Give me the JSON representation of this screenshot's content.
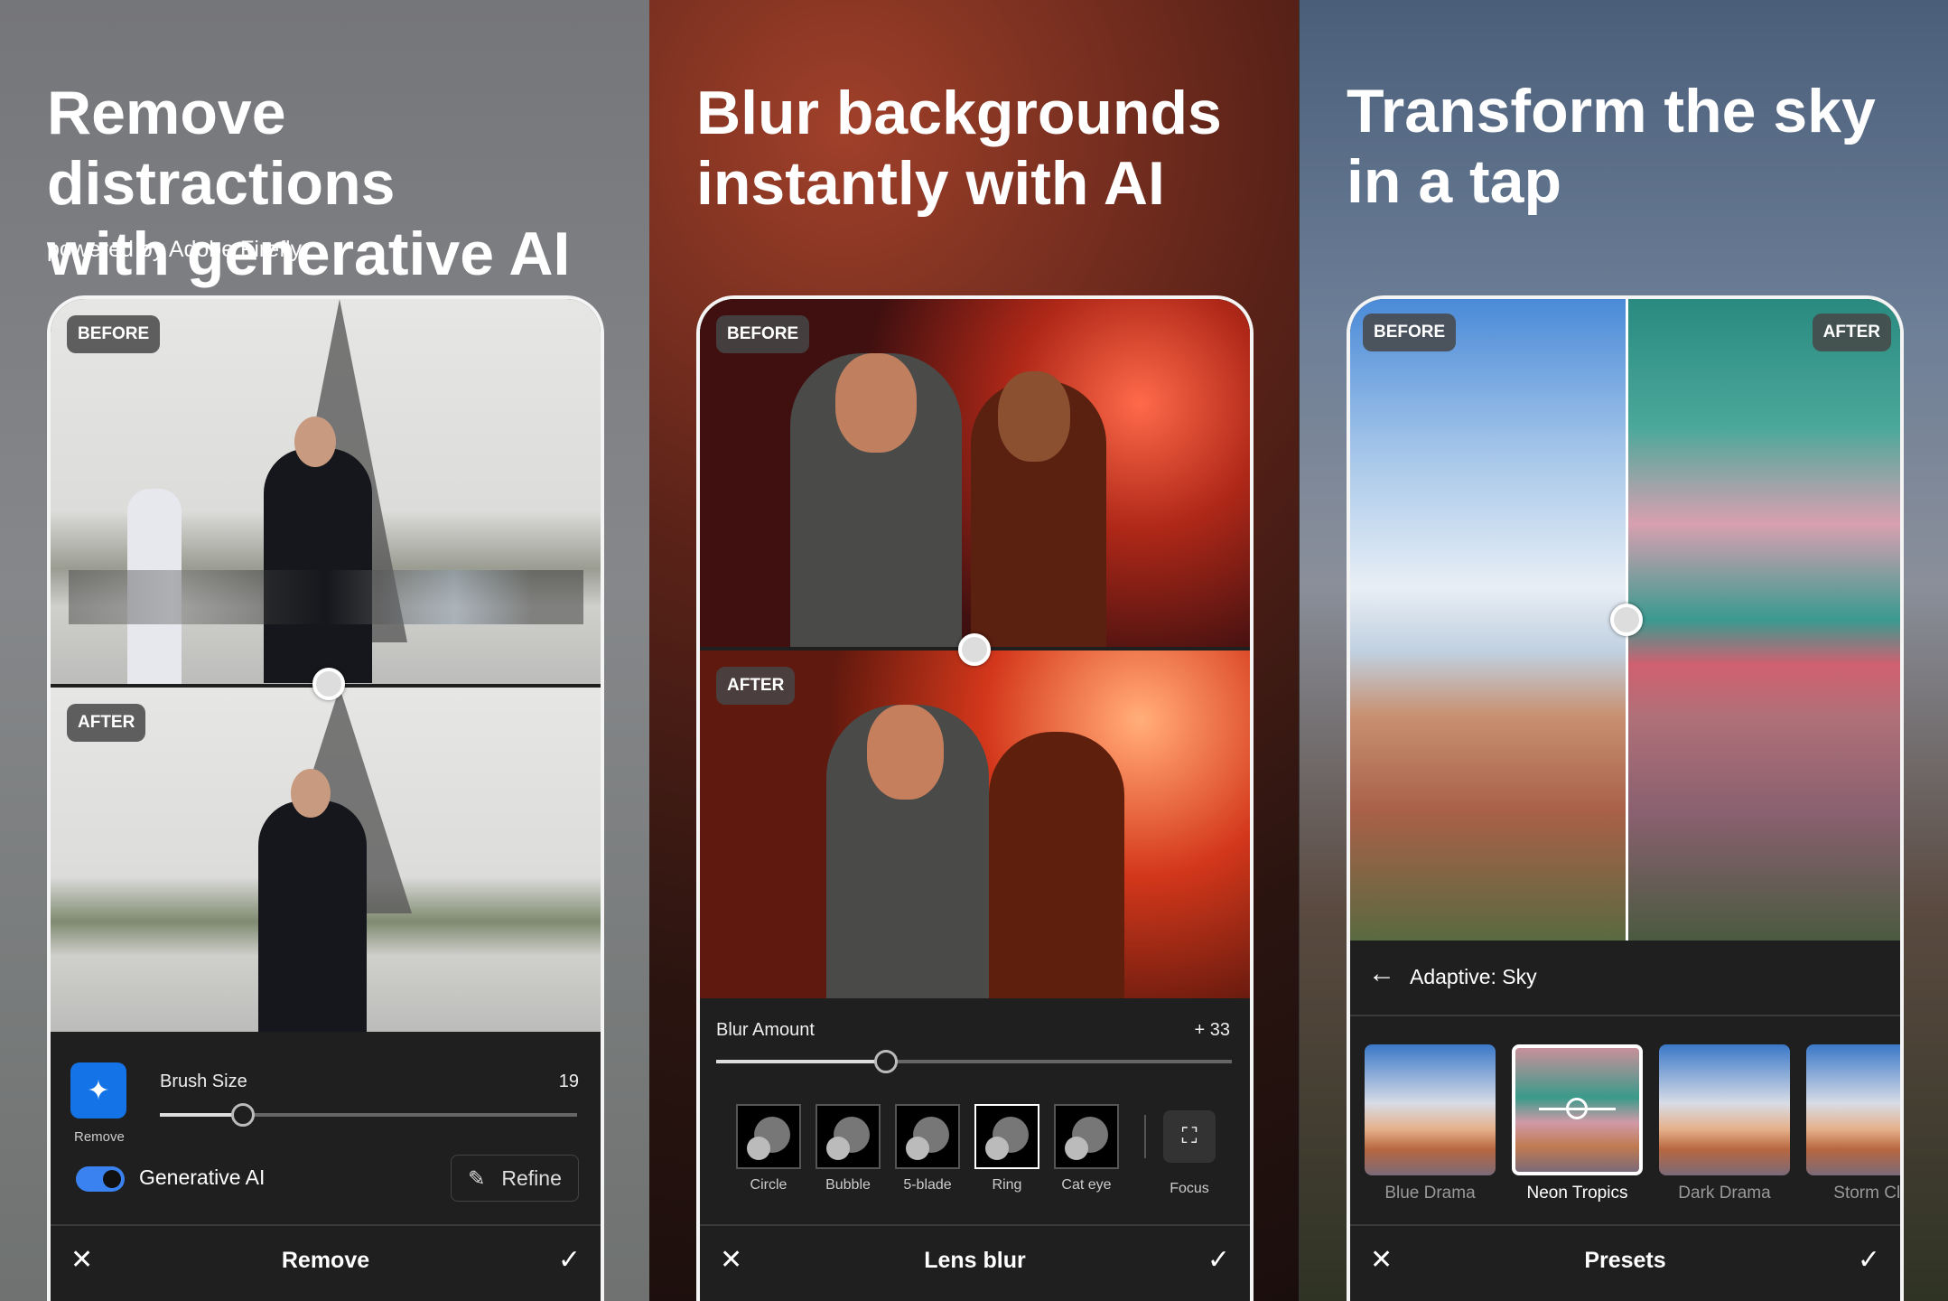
{
  "panels": [
    {
      "headline_1": "Remove distractions",
      "headline_2": "with generative AI",
      "subtitle": "powered by Adobe Firefly",
      "before_label": "BEFORE",
      "after_label": "AFTER",
      "tool_label": "Remove",
      "slider_label": "Brush Size",
      "slider_value": "19",
      "slider_fraction": 0.2,
      "toggle_label": "Generative AI",
      "toggle_on": true,
      "refine_label": "Refine",
      "bottom_title": "Remove"
    },
    {
      "headline_1": "Blur backgrounds",
      "headline_2": "instantly with AI",
      "before_label": "BEFORE",
      "after_label": "AFTER",
      "slider_label": "Blur Amount",
      "slider_value": "+ 33",
      "slider_fraction": 0.33,
      "shapes": [
        "Circle",
        "Bubble",
        "5-blade",
        "Ring",
        "Cat eye"
      ],
      "selected_shape": "Ring",
      "focus_label": "Focus",
      "bottom_title": "Lens blur"
    },
    {
      "headline_1": "Transform the sky",
      "headline_2": "in a tap",
      "before_label": "BEFORE",
      "after_label": "AFTER",
      "header_title": "Adaptive: Sky",
      "presets": [
        "Blue Drama",
        "Neon Tropics",
        "Dark Drama",
        "Storm Clo"
      ],
      "selected_preset": "Neon Tropics",
      "bottom_title": "Presets"
    }
  ],
  "colors": {
    "accent": "#1473e6",
    "panel_bg": "#1f1f1f"
  }
}
